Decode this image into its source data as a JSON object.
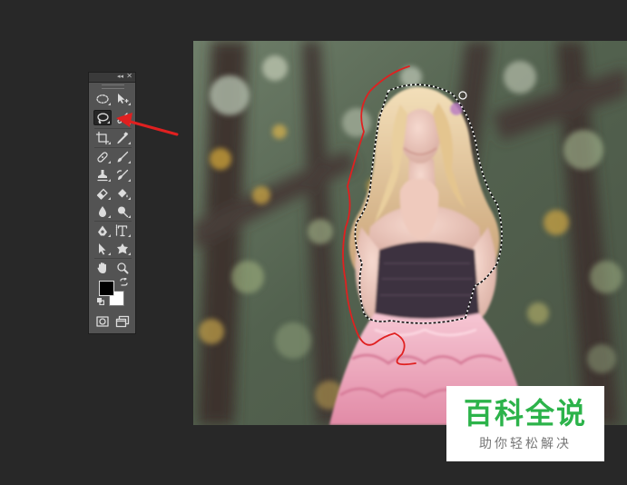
{
  "tools_panel": {
    "collapse_glyph": "◂◂",
    "close_glyph": "✕",
    "tools": [
      {
        "name": "elliptical-marquee-tool",
        "icon": "ellipse-dashed-icon"
      },
      {
        "name": "move-tool",
        "icon": "move-arrow-icon"
      },
      {
        "name": "lasso-tool",
        "icon": "lasso-icon",
        "active": true
      },
      {
        "name": "quick-selection-tool",
        "icon": "quick-selection-brush-icon"
      },
      {
        "name": "crop-tool",
        "icon": "crop-icon"
      },
      {
        "name": "eyedropper-tool",
        "icon": "eyedropper-icon"
      },
      {
        "name": "spot-healing-tool",
        "icon": "bandage-icon"
      },
      {
        "name": "brush-tool",
        "icon": "brush-icon"
      },
      {
        "name": "clone-stamp-tool",
        "icon": "stamp-icon"
      },
      {
        "name": "history-brush-tool",
        "icon": "history-brush-icon"
      },
      {
        "name": "eraser-tool",
        "icon": "eraser-icon"
      },
      {
        "name": "paint-bucket-tool",
        "icon": "bucket-icon"
      },
      {
        "name": "blur-tool",
        "icon": "drop-icon"
      },
      {
        "name": "dodge-tool",
        "icon": "dodge-icon"
      },
      {
        "name": "pen-tool",
        "icon": "pen-nib-icon"
      },
      {
        "name": "type-tool",
        "icon": "type-t-icon"
      },
      {
        "name": "path-selection-tool",
        "icon": "arrow-pointer-icon"
      },
      {
        "name": "custom-shape-tool",
        "icon": "shape-blob-icon"
      },
      {
        "name": "hand-tool",
        "icon": "hand-icon"
      },
      {
        "name": "zoom-tool",
        "icon": "magnifier-icon"
      }
    ],
    "foreground_color": "#000000",
    "background_color": "#ffffff"
  },
  "annotations": {
    "arrow_color": "#e02020",
    "lasso_stroke_color": "#e02020"
  },
  "watermark": {
    "title": "百科全说",
    "subtitle": "助你轻松解决",
    "title_color": "#2cb34a"
  },
  "colors": {
    "workspace_bg": "#282828",
    "panel_bg": "#535353"
  }
}
